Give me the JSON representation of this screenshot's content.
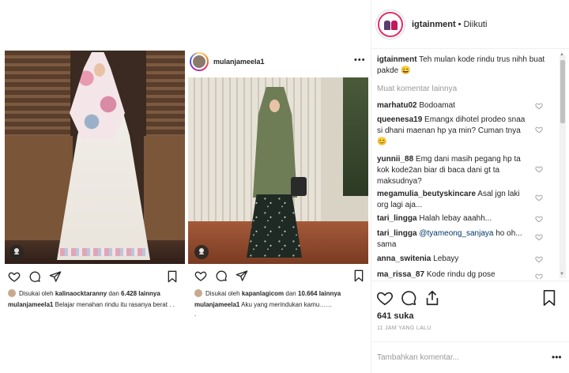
{
  "post_image": {
    "card1": {
      "liked_prefix": "Disukai oleh",
      "liked_user": "kalinaocktaranny",
      "liked_and": "dan",
      "liked_count": "6.428 lainnya",
      "caption_user": "mulanjameela1",
      "caption_text": "Belajar menahan rindu itu rasanya berat . ."
    },
    "card2": {
      "username": "mulanjameela1",
      "more": "•••",
      "liked_prefix": "Disukai oleh",
      "liked_user": "kapanlagicom",
      "liked_and": "dan",
      "liked_count": "10.664 lainnya",
      "caption_user": "mulanjameela1",
      "caption_text": "Aku yang merindukan kamu……",
      "caption_dot": "."
    }
  },
  "panel": {
    "header": {
      "username": "igtainment",
      "separator": "•",
      "follow_status": "Diikuti"
    },
    "caption": {
      "user": "igtainment",
      "text": "Teh mulan kode rindu trus nihh buat pakde 😄"
    },
    "load_more": "Muat komentar lainnya",
    "comments": [
      {
        "user": "marhatu02",
        "text": "Bodoamat"
      },
      {
        "user": "queenesa19",
        "text": "Emangx dihotel prodeo snaa si dhani maenan hp ya min? Cuman tnya 😊"
      },
      {
        "user": "yunnii_88",
        "text": "Emg dani masih pegang hp ta kok kode2an biar di baca dani gt ta maksudnya?"
      },
      {
        "user": "megamulia_beutyskincare",
        "text": "Asal jgn laki org lagi aja..."
      },
      {
        "user": "tari_lingga",
        "text": "Halah lebay aaahh..."
      },
      {
        "user": "tari_lingga",
        "mention": "@tyameong_sanjaya",
        "text": "ho oh... sama"
      },
      {
        "user": "anna_switenia",
        "text": "Lebayy"
      },
      {
        "user": "ma_rissa_87",
        "text": "Kode rindu dg pose"
      }
    ],
    "likes": "641 suka",
    "timestamp": "11 JAM YANG LALU",
    "add_comment_placeholder": "Tambahkan komentar...",
    "more": "•••"
  },
  "colors": {
    "text": "#262626",
    "muted": "#999999",
    "border": "#efefef",
    "mention": "#003569"
  }
}
